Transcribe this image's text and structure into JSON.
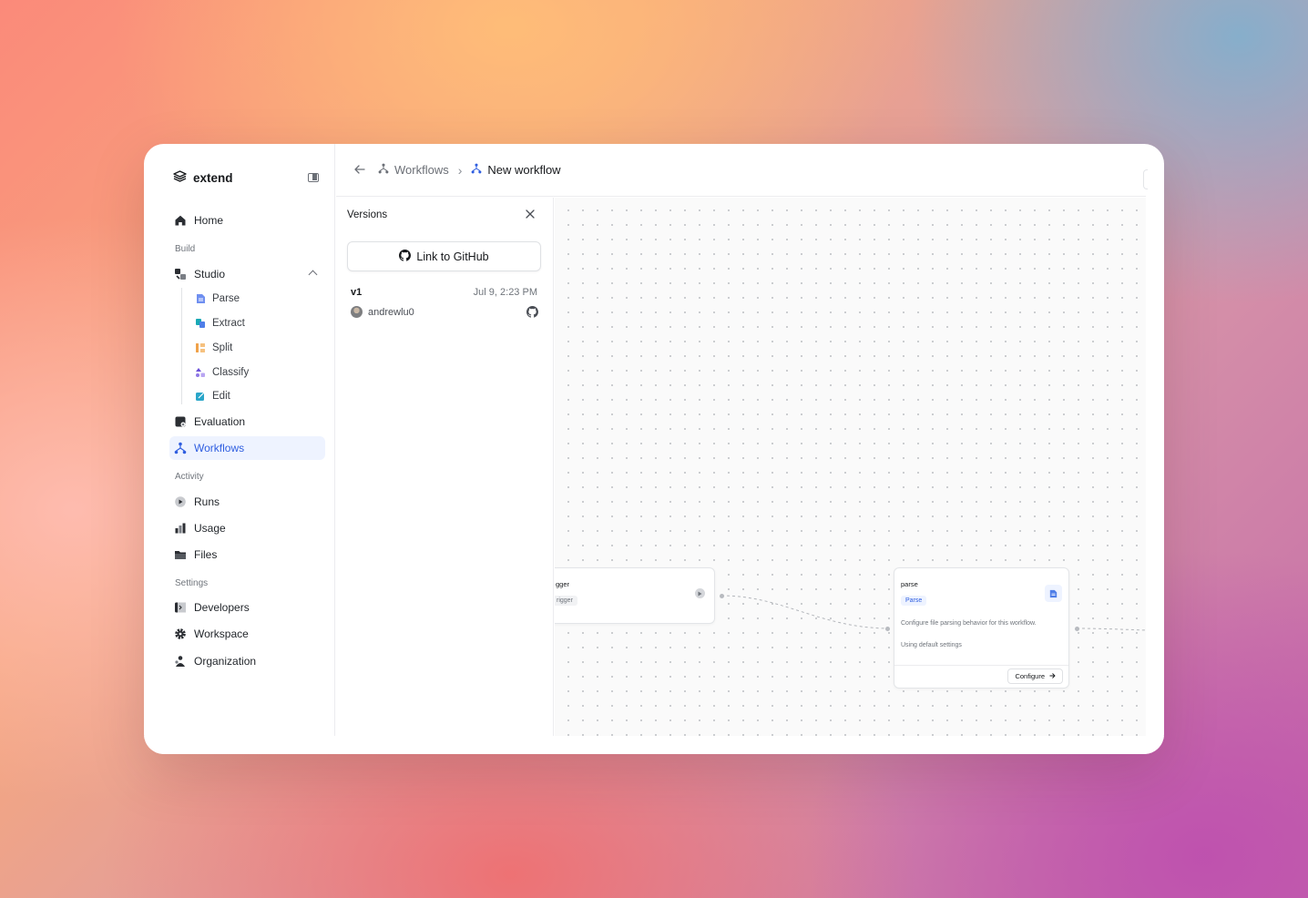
{
  "brand": {
    "name": "extend"
  },
  "nav": {
    "home": "Home",
    "section_build": "Build",
    "studio": "Studio",
    "studio_items": [
      "Parse",
      "Extract",
      "Split",
      "Classify",
      "Edit"
    ],
    "evaluation": "Evaluation",
    "workflows": "Workflows",
    "section_activity": "Activity",
    "runs": "Runs",
    "usage": "Usage",
    "files": "Files",
    "section_settings": "Settings",
    "developers": "Developers",
    "workspace": "Workspace",
    "organization": "Organization"
  },
  "breadcrumb": {
    "parent": "Workflows",
    "current": "New workflow"
  },
  "versions": {
    "title": "Versions",
    "link_github": "Link to GitHub",
    "entries": [
      {
        "name": "v1",
        "date": "Jul 9, 2:23 PM",
        "user": "andrewlu0"
      }
    ]
  },
  "canvas": {
    "trigger_node": {
      "title": "gger",
      "pill": "rigger"
    },
    "parse_node": {
      "title": "parse",
      "pill": "Parse",
      "description": "Configure file parsing behavior for this workflow.",
      "settings": "Using default settings",
      "configure": "Configure"
    }
  },
  "colors": {
    "accent": "#2f5ee0",
    "active_bg": "#eef3ff"
  },
  "icons": [
    "extend-logo-icon",
    "sidebar-toggle-icon",
    "home-icon",
    "studio-icon",
    "parse-icon",
    "extract-icon",
    "split-icon",
    "classify-icon",
    "edit-icon",
    "evaluation-icon",
    "workflows-icon",
    "runs-icon",
    "usage-icon",
    "files-icon",
    "developers-icon",
    "workspace-icon",
    "organization-icon",
    "back-arrow-icon",
    "github-icon",
    "close-icon"
  ]
}
